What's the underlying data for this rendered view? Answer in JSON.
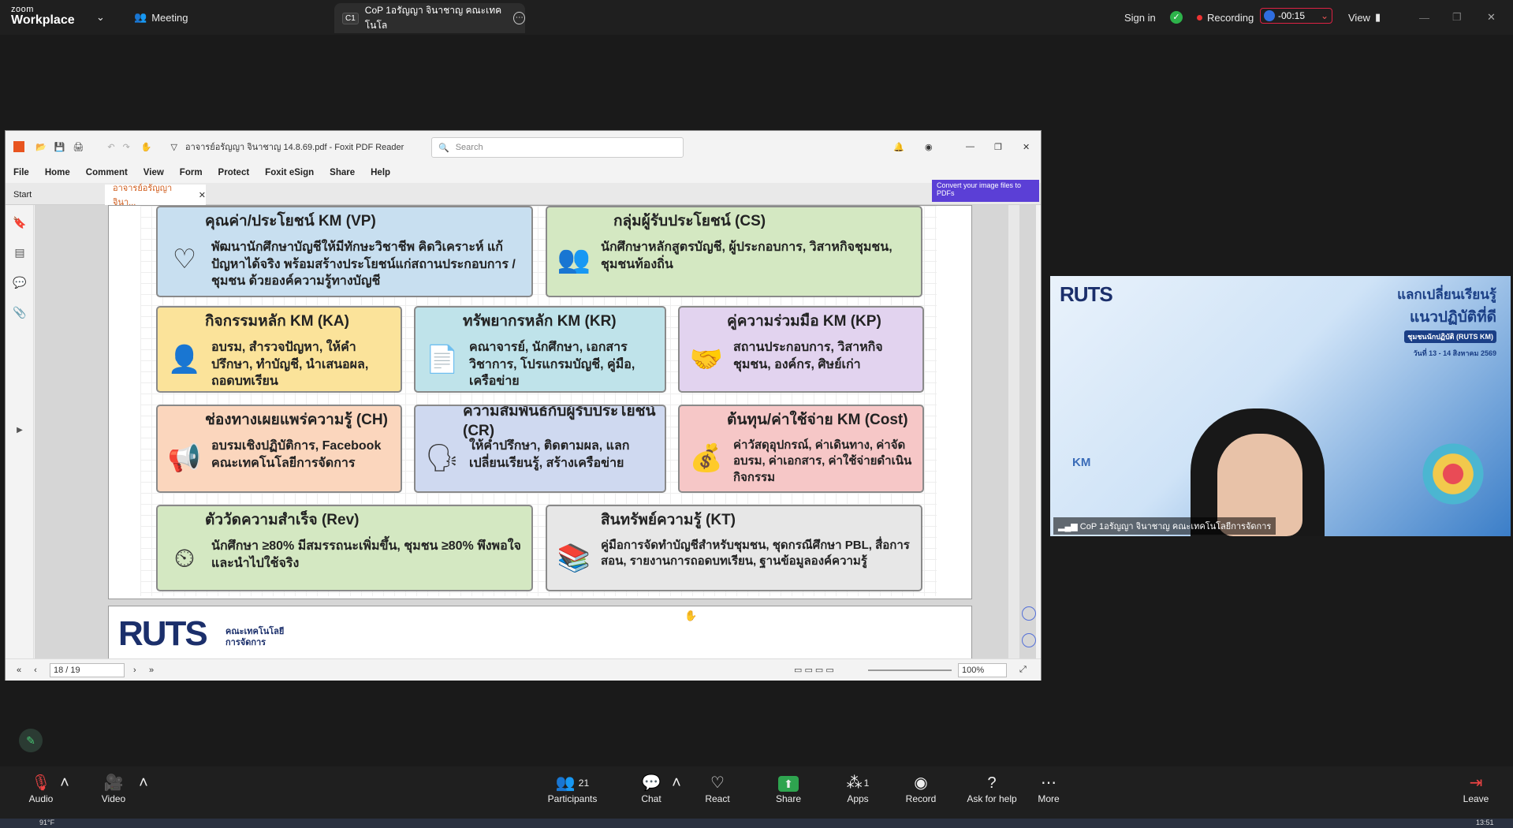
{
  "zoom": {
    "logo_top": "zoom",
    "logo_bottom": "Workplace",
    "meeting_label": "Meeting",
    "tab_badge": "C1",
    "tab_title": "CoP 1อรัญญา จินาชาญ คณะเทคโนโล",
    "sign_in": "Sign in",
    "recording": "Recording",
    "timer": "-00:15",
    "view": "View"
  },
  "pdf": {
    "title": "อาจารย์อรัญญา  จินาชาญ 14.8.69.pdf - Foxit PDF Reader",
    "search_placeholder": "Search",
    "menu": [
      "File",
      "Home",
      "Comment",
      "View",
      "Form",
      "Protect",
      "Foxit eSign",
      "Share",
      "Help"
    ],
    "tab_start": "Start",
    "tab_doc": "อาจารย์อรัญญา  จินา...",
    "convert_banner": "Convert your image files to PDFs",
    "page_indicator": "18 / 19",
    "zoom_level": "100%",
    "cards": {
      "vp": {
        "title": "คุณค่า/ประโยชน์ KM (VP)",
        "body": "พัฒนานักศึกษาบัญชีให้มีทักษะวิชาชีพ คิดวิเคราะห์ แก้ปัญหาได้จริง พร้อมสร้างประโยชน์แก่สถานประกอบการ / ชุมชน ด้วยองค์ความรู้ทางบัญชี"
      },
      "cs": {
        "title": "กลุ่มผู้รับประโยชน์ (CS)",
        "body": "นักศึกษาหลักสูตรบัญชี, ผู้ประกอบการ, วิสาหกิจชุมชน, ชุมชนท้องถิ่น"
      },
      "ka": {
        "title": "กิจกรรมหลัก KM (KA)",
        "body": "อบรม, สำรวจปัญหา, ให้คำปรึกษา, ทำบัญชี, นำเสนอผล, ถอดบทเรียน"
      },
      "kr": {
        "title": "ทรัพยากรหลัก KM (KR)",
        "body": "คณาจารย์, นักศึกษา, เอกสารวิชาการ, โปรแกรมบัญชี, คู่มือ, เครือข่าย"
      },
      "kp": {
        "title": "คู่ความร่วมมือ KM (KP)",
        "body": "สถานประกอบการ, วิสาหกิจชุมชน, องค์กร, ศิษย์เก่า"
      },
      "ch": {
        "title": "ช่องทางเผยแพร่ความรู้ (CH)",
        "body": "อบรมเชิงปฏิบัติการ, Facebook คณะเทคโนโลยีการจัดการ"
      },
      "cr": {
        "title": "ความสัมพันธ์กับผู้รับประโยชน์ (CR)",
        "body": "ให้คำปรึกษา, ติดตามผล, แลกเปลี่ยนเรียนรู้, สร้างเครือข่าย"
      },
      "cost": {
        "title": "ต้นทุน/ค่าใช้จ่าย KM (Cost)",
        "body": "ค่าวัสดุอุปกรณ์, ค่าเดินทาง, ค่าจัดอบรม, ค่าเอกสาร, ค่าใช้จ่ายดำเนินกิจกรรม"
      },
      "rev": {
        "title": "ตัววัดความสำเร็จ (Rev)",
        "body": "นักศึกษา ≥80% มีสมรรถนะเพิ่มขึ้น, ชุมชน ≥80% พึงพอใจและนำไปใช้จริง"
      },
      "kt": {
        "title": "สินทรัพย์ความรู้ (KT)",
        "body": "คู่มือการจัดทำบัญชีสำหรับชุมชน, ชุดกรณีศึกษา PBL, สื่อการสอน, รายงานการถอดบทเรียน, ฐานข้อมูลองค์ความรู้"
      }
    },
    "footer_logo": "RUTS",
    "footer_faculty_1": "คณะเทคโนโลยี",
    "footer_faculty_2": "การจัดการ"
  },
  "video": {
    "banner_line1": "แลกเปลี่ยนเรียนรู้",
    "banner_line2": "แนวปฏิบัติที่ดี",
    "banner_line3": "ชุมชนนักปฏิบัติ (RUTS KM)",
    "banner_date": "วันที่ 13 - 14 สิงหาคม 2569",
    "logo": "RUTS",
    "km_label": "KM",
    "participant_name": "CoP 1อรัญญา จินาชาญ คณะเทคโนโลยีการจัดการ"
  },
  "bottombar": {
    "audio": "Audio",
    "video": "Video",
    "participants": "Participants",
    "participants_count": "21",
    "chat": "Chat",
    "react": "React",
    "share": "Share",
    "apps": "Apps",
    "apps_count": "1",
    "record": "Record",
    "ask_help": "Ask for help",
    "more": "More",
    "leave": "Leave"
  },
  "taskbar": {
    "weather": "91°F",
    "time": "13:51"
  }
}
